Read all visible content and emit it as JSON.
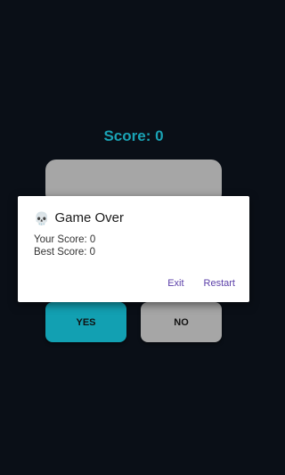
{
  "game": {
    "score_label": "Score: 0",
    "yes_label": "YES",
    "no_label": "NO",
    "colors": {
      "background": "#0a0f17",
      "accent": "#1aa3b5",
      "yes_button": "#12a0b2",
      "neutral": "#a6a6a6"
    }
  },
  "dialog": {
    "icon": "skull-icon",
    "icon_glyph": "💀",
    "title": "Game Over",
    "your_score": "Your Score: 0",
    "best_score": "Best Score: 0",
    "exit_label": "Exit",
    "restart_label": "Restart",
    "action_color": "#5b3fa8"
  }
}
